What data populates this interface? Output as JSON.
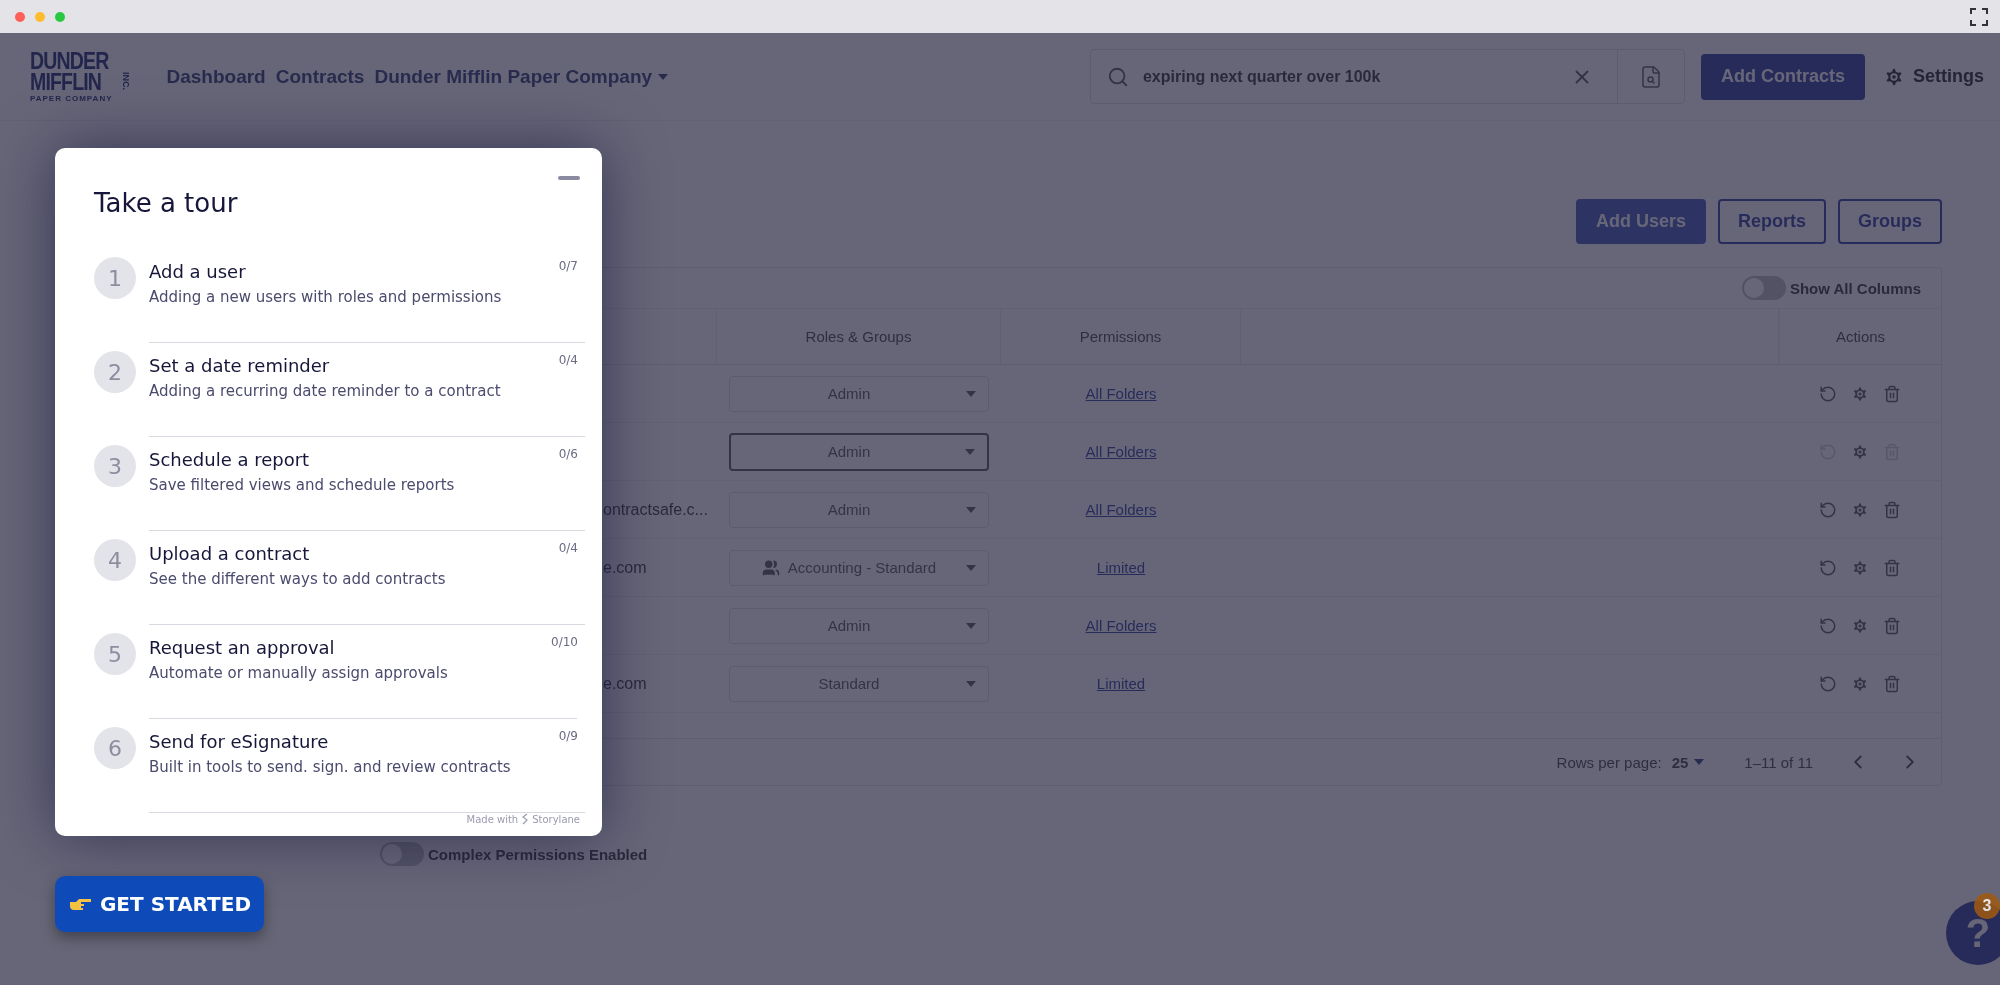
{
  "nav": {
    "logo": {
      "line1": "DUNDER",
      "line2": "MIFFLIN",
      "suffix": "INC.",
      "tagline": "PAPER COMPANY"
    },
    "links": [
      "Dashboard",
      "Contracts"
    ],
    "company": "Dunder Mifflin Paper Company"
  },
  "search": {
    "value": "expiring next quarter over 100k"
  },
  "add_contracts": "Add Contracts",
  "settings": "Settings",
  "actions": [
    {
      "label": "Add Users",
      "kind": "primary"
    },
    {
      "label": "Reports",
      "kind": "outline"
    },
    {
      "label": "Groups",
      "kind": "outline"
    }
  ],
  "show_all_columns": {
    "label": "Show All Columns",
    "on": false
  },
  "table": {
    "columns": [
      "Roles & Groups",
      "Permissions",
      "Actions"
    ],
    "rows": [
      {
        "email": "",
        "kind": "role",
        "role": "Admin",
        "outlined": false,
        "permission": "All Folders",
        "locked": false
      },
      {
        "email": "",
        "kind": "role",
        "role": "Admin",
        "outlined": true,
        "permission": "All Folders",
        "locked": true
      },
      {
        "email": "ontractsafe.c...",
        "kind": "role",
        "role": "Admin",
        "outlined": false,
        "permission": "All Folders",
        "locked": false
      },
      {
        "email": "e.com",
        "kind": "group",
        "role": "Accounting - Standard",
        "outlined": false,
        "permission": "Limited",
        "locked": false
      },
      {
        "email": "",
        "kind": "role",
        "role": "Admin",
        "outlined": false,
        "permission": "All Folders",
        "locked": false
      },
      {
        "email": "e.com",
        "kind": "role",
        "role": "Standard",
        "outlined": false,
        "permission": "Limited",
        "locked": false
      }
    ],
    "footer": {
      "rows_per_page_label": "Rows per page:",
      "rows_per_page": "25",
      "range": "1–11 of 11"
    }
  },
  "complex_permissions": {
    "label": "Complex Permissions Enabled",
    "on": false
  },
  "help": {
    "glyph": "?",
    "badge": "3"
  },
  "tour": {
    "title": "Take a tour",
    "steps": [
      {
        "number": "1",
        "title": "Add a user",
        "description": "Adding a new users with roles and permissions",
        "progress": "0/7"
      },
      {
        "number": "2",
        "title": "Set a date reminder",
        "description": "Adding a recurring date reminder to a contract",
        "progress": "0/4"
      },
      {
        "number": "3",
        "title": "Schedule a report",
        "description": "Save filtered views and schedule reports",
        "progress": "0/6"
      },
      {
        "number": "4",
        "title": "Upload a contract",
        "description": "See the different ways to add contracts",
        "progress": "0/4"
      },
      {
        "number": "5",
        "title": "Request an approval",
        "description": "Automate or manually assign approvals",
        "progress": "0/10"
      },
      {
        "number": "6",
        "title": "Send for eSignature",
        "description": "Built in tools to send. sign. and review contracts",
        "progress": "0/9"
      }
    ],
    "credit": {
      "prefix": "Made with",
      "brand": "Storylane"
    }
  },
  "get_started": {
    "label": "GET STARTED"
  }
}
